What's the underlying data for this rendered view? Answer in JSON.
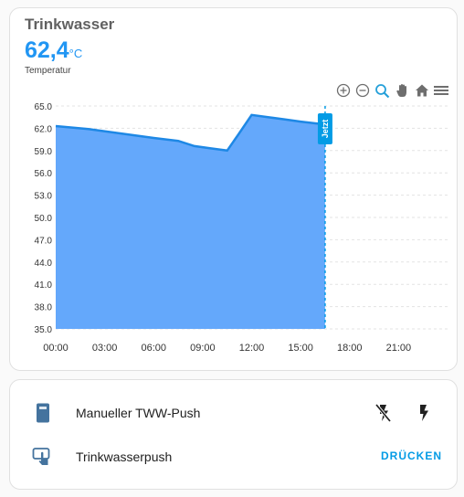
{
  "card": {
    "title": "Trinkwasser",
    "value": "62,4",
    "unit": "°C",
    "subtitle": "Temperatur"
  },
  "toolbar": {
    "icons": [
      "zoom-in-icon",
      "zoom-out-icon",
      "zoom-selection-icon",
      "pan-hand-icon",
      "home-reset-icon",
      "menu-icon"
    ],
    "accent": "#26a0d9"
  },
  "chart_data": {
    "type": "area",
    "color": "#1e88e5",
    "fill": "#64a8fb",
    "x_labels": [
      "00:00",
      "03:00",
      "06:00",
      "09:00",
      "12:00",
      "15:00",
      "18:00",
      "21:00"
    ],
    "y_ticks": [
      "35.0",
      "38.0",
      "41.0",
      "44.0",
      "47.0",
      "50.0",
      "53.0",
      "56.0",
      "59.0",
      "62.0",
      "65.0"
    ],
    "ylim": [
      35,
      65
    ],
    "xlim": [
      0,
      24
    ],
    "grid": true,
    "series": [
      {
        "x": [
          0,
          2,
          4,
          6,
          7.5,
          8.5,
          9.5,
          10.5,
          11.2,
          12,
          13,
          14,
          15,
          16.5
        ],
        "y": [
          62.3,
          61.9,
          61.3,
          60.7,
          60.3,
          59.6,
          59.3,
          59.0,
          61.2,
          63.8,
          63.5,
          63.2,
          62.9,
          62.5
        ]
      }
    ],
    "now_marker": {
      "x": 16.5,
      "label": "Jetzt",
      "color": "#039be5"
    }
  },
  "controls": [
    {
      "label": "Manueller TWW-Push",
      "icon": "remote-device-icon"
    },
    {
      "label": "Trinkwasserpush",
      "icon": "push-button-icon",
      "action": "DRÜCKEN"
    }
  ]
}
